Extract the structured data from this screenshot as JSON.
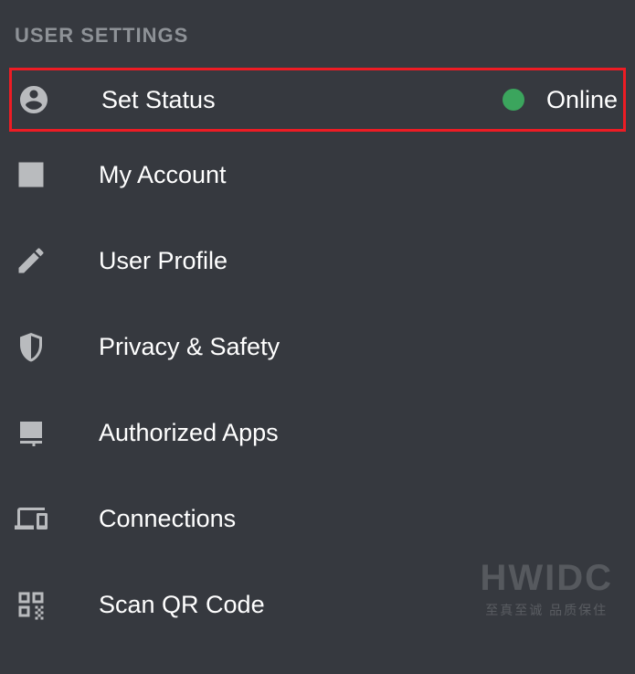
{
  "header": {
    "title": "USER SETTINGS"
  },
  "status": {
    "label": "Set Status",
    "value_text": "Online",
    "dot_color": "#3ba55d"
  },
  "menu": [
    {
      "id": "my-account",
      "label": "My Account",
      "icon": "account"
    },
    {
      "id": "user-profile",
      "label": "User Profile",
      "icon": "pencil"
    },
    {
      "id": "privacy-safety",
      "label": "Privacy & Safety",
      "icon": "shield"
    },
    {
      "id": "authorized-apps",
      "label": "Authorized Apps",
      "icon": "apps"
    },
    {
      "id": "connections",
      "label": "Connections",
      "icon": "devices"
    },
    {
      "id": "scan-qr-code",
      "label": "Scan QR Code",
      "icon": "qr"
    }
  ],
  "watermark": {
    "big": "HWIDC",
    "small": "至真至诚 品质保住"
  },
  "colors": {
    "background": "#36393f",
    "highlight_border": "#ed1c24",
    "icon": "#b9bbbe",
    "text_primary": "#ffffff",
    "text_muted": "#8e9297"
  }
}
